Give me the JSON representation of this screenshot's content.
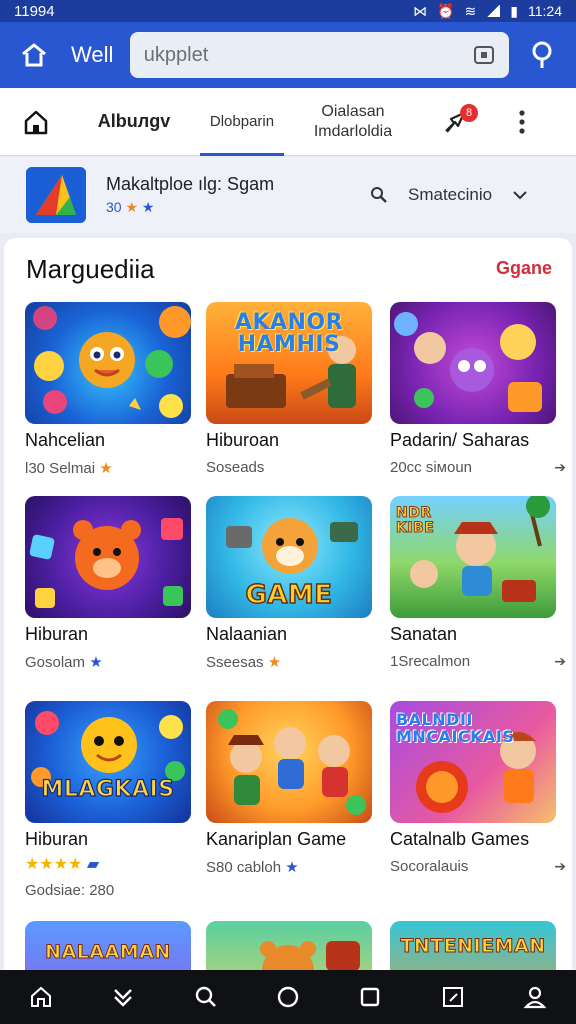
{
  "status_bar": {
    "left": "11994",
    "right_text": "ᏅᏅ",
    "time": "11:24"
  },
  "app_bar": {
    "title": "Well",
    "search_placeholder": "ukpplet"
  },
  "tabs": {
    "albums": "Albuлgv",
    "dlobpam": "Dlobparin",
    "two_line_1": "Oialasan",
    "two_line_2": "Imdarloldia",
    "badge": "8"
  },
  "marketplace": {
    "title": "Makaltploe ılg: Sgam",
    "rating": "30",
    "search_label": "Smatecinio"
  },
  "section": {
    "title": "Marguediia",
    "link": "Ggane"
  },
  "games": [
    {
      "name": "Nahcelian",
      "sub": "Ɩ30 Selmai",
      "star": "orange",
      "art": "Bubble characters"
    },
    {
      "name": "Hiburoan",
      "sub": "Soseads",
      "star": "",
      "art": "AKANOR HAMHIS"
    },
    {
      "name": "Padarin/ Saharas",
      "sub": "20cc siмoun",
      "star": "",
      "art": "Cute monsters"
    },
    {
      "name": "Hiburan",
      "sub": "Gosolam",
      "star": "blue",
      "art": "Bear puzzle"
    },
    {
      "name": "Nalaanian",
      "sub": "Sseesas",
      "star": "orange",
      "art": "GAME"
    },
    {
      "name": "Sanatan",
      "sub": "1Srecalmon",
      "star": "",
      "art": "NDR KIBE"
    },
    {
      "name": "Hiburan",
      "sub": "",
      "extra": "Godsiae: 280",
      "star": "rating",
      "art": "MLAGKAIS"
    },
    {
      "name": "Kanariplan Game",
      "sub": "S80 cabloh",
      "star": "blue",
      "art": "Adventurers"
    },
    {
      "name": "Catalnalb Games",
      "sub": "Socoralauis",
      "star": "",
      "art": "BALNDII MNCAICKAIS"
    },
    {
      "name": "",
      "sub": "",
      "star": "",
      "art": "NALAAMAN"
    },
    {
      "name": "",
      "sub": "",
      "star": "",
      "art": "Bear"
    },
    {
      "name": "",
      "sub": "",
      "star": "",
      "art": "TNTENIEMAN"
    }
  ],
  "thumb_texts": {
    "t2": "AKANOR\nHAMHIS",
    "t5": "GAME",
    "t6": "NDR\nKIBE",
    "t7": "MLAGKAIS",
    "t9": "BALNDII\nMNCAICKAIS",
    "t10": "NALAAMAN",
    "t12": "TNTENIEMAN"
  },
  "colors": {
    "accent": "#2857d1",
    "status": "#1d3d9e",
    "link": "#d42c3c",
    "star": "#f5b400"
  }
}
